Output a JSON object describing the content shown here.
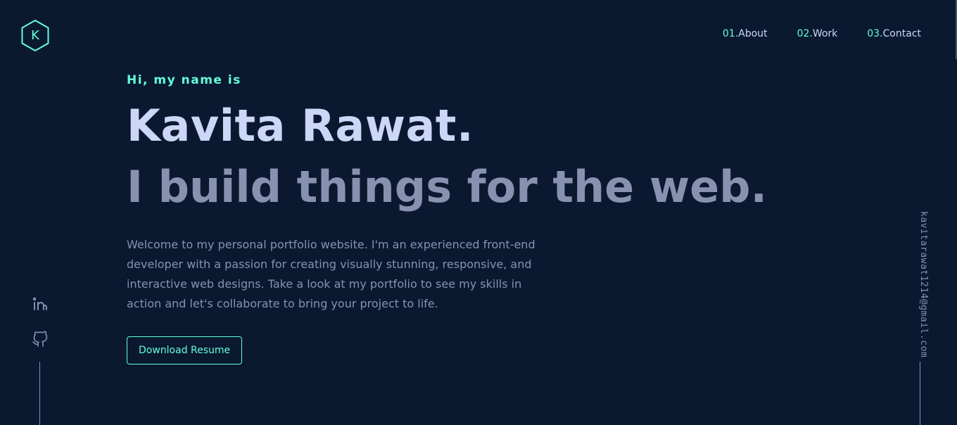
{
  "logo": {
    "letter": "K",
    "icon": "hexagon-logo-icon"
  },
  "nav": {
    "items": [
      {
        "num": "01.",
        "label": "About"
      },
      {
        "num": "02.",
        "label": "Work"
      },
      {
        "num": "03.",
        "label": "Contact"
      }
    ]
  },
  "hero": {
    "greeting": "Hi, my name is",
    "name": "Kavita Rawat.",
    "tagline": "I build things for the web.",
    "intro": "Welcome to my personal portfolio website. I'm an experienced front-end developer with a passion for creating visually stunning, responsive, and interactive web designs. Take a look at my portfolio to see my skills in action and let's collaborate to bring your project to life.",
    "resume_button": "Download Resume"
  },
  "social": {
    "items": [
      {
        "icon": "linkedin-icon"
      },
      {
        "icon": "github-icon"
      }
    ]
  },
  "email": "kavitarawat1214@gmail.com",
  "colors": {
    "background": "#0a192f",
    "accent": "#64ffda",
    "heading": "#ccd6f6",
    "muted": "#8892b0"
  }
}
